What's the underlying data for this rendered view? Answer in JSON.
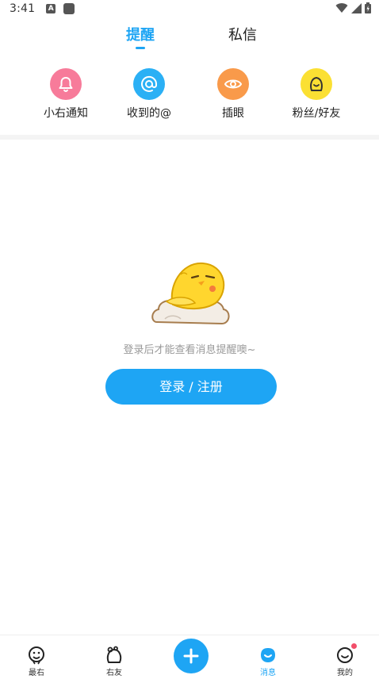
{
  "status_bar": {
    "time": "3:41",
    "notification_letter": "A"
  },
  "tabs": {
    "remind": "提醒",
    "private_message": "私信"
  },
  "categories": [
    {
      "label": "小右通知",
      "icon": "bell-icon",
      "color": "#f77b9a"
    },
    {
      "label": "收到的@",
      "icon": "at-icon",
      "color": "#2bb0f5"
    },
    {
      "label": "插眼",
      "icon": "eye-icon",
      "color": "#f99a4a"
    },
    {
      "label": "粉丝/好友",
      "icon": "friend-icon",
      "color": "#fbe033"
    }
  ],
  "empty_state": {
    "message": "登录后才能查看消息提醒噢~",
    "button_label": "登录 / 注册"
  },
  "bottom_nav": {
    "items": [
      {
        "label": "最右",
        "icon": "zuiyou-face-icon",
        "active": false
      },
      {
        "label": "右友",
        "icon": "youyou-icon",
        "active": false
      },
      {
        "label": "消息",
        "icon": "message-icon",
        "active": true
      },
      {
        "label": "我的",
        "icon": "profile-icon",
        "active": false
      }
    ],
    "post_icon": "plus-icon"
  },
  "colors": {
    "accent": "#1ea5f4",
    "text_muted": "#999999",
    "badge": "#f24e6a"
  }
}
